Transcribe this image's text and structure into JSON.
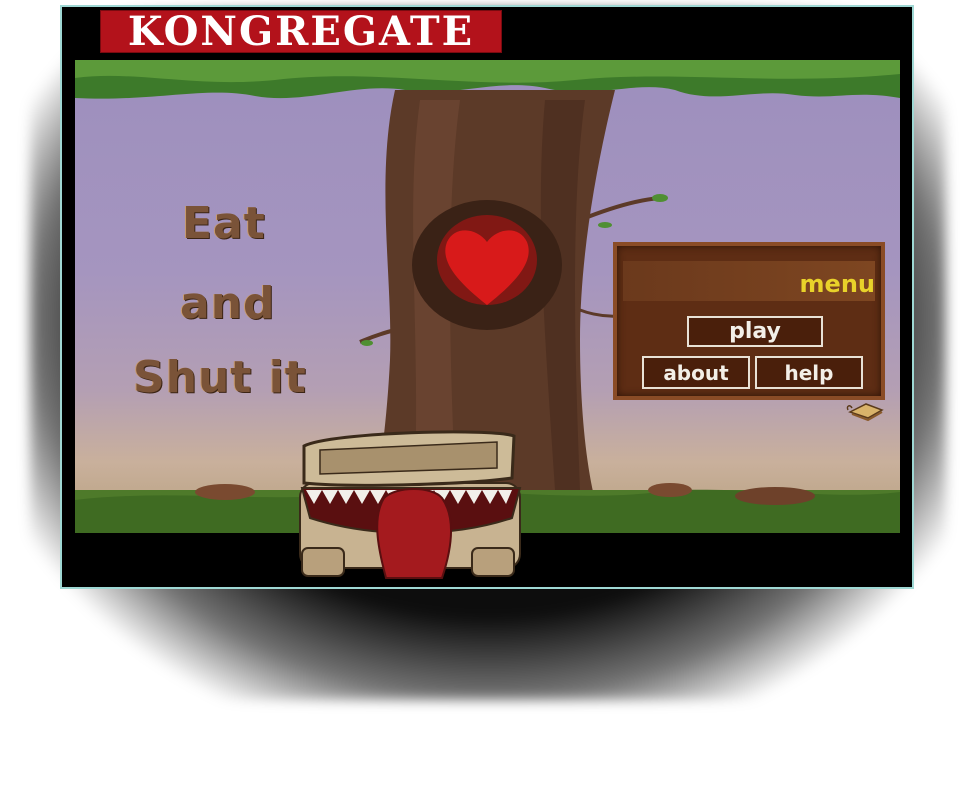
{
  "site": {
    "logo_text": "KONGREGATE"
  },
  "game": {
    "title_lines": [
      "Eat",
      "and",
      "Shut it"
    ],
    "menu": {
      "label": "menu",
      "play_label": "play",
      "about_label": "about",
      "help_label": "help"
    }
  },
  "colors": {
    "kongregate_red": "#b3121b",
    "sky": "#9d8fbe",
    "menu_wood": "#5e2d14",
    "menu_text_yellow": "#e8d22a",
    "heart": "#d81a1a"
  },
  "icons": {
    "menu_corner": "sandwich-icon"
  }
}
